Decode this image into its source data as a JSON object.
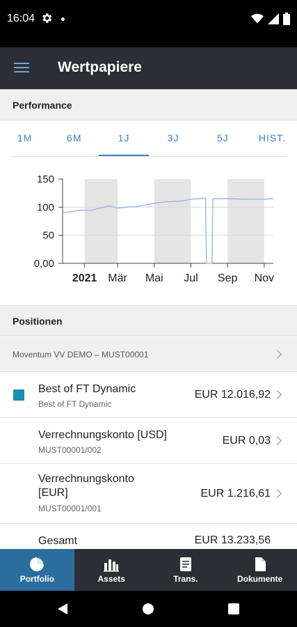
{
  "status": {
    "time": "16:04"
  },
  "appbar": {
    "title": "Wertpapiere"
  },
  "performance": {
    "header": "Performance",
    "tabs": [
      "1M",
      "6M",
      "1J",
      "3J",
      "5J",
      "HIST."
    ],
    "active_tab": "1J"
  },
  "chart_data": {
    "type": "line",
    "y_ticks": [
      "150",
      "100",
      "50",
      "0,00"
    ],
    "x_ticks": [
      "2021",
      "Mär",
      "Mai",
      "Jul",
      "Sep",
      "Nov"
    ],
    "ylim": [
      0,
      150
    ],
    "x": [
      0,
      0.5,
      1,
      1.5,
      2,
      2.5,
      3,
      3.5,
      4,
      4.5,
      5,
      5.5,
      6,
      6.5,
      7,
      7.5,
      7.8,
      7.85,
      7.9,
      8.15,
      8.2,
      8.3,
      9,
      10,
      10.5,
      11,
      11.5
    ],
    "values": [
      90,
      92,
      95,
      94,
      98,
      102,
      98,
      100,
      101,
      104,
      107,
      109,
      110,
      111,
      114,
      115,
      116,
      0,
      0,
      0,
      114,
      115,
      115,
      114,
      114,
      114,
      115
    ],
    "line_color": "#8fb6dd",
    "shade_color": "#e5e5e5"
  },
  "positions": {
    "header": "Positionen",
    "portfolio": "Moventum VV DEMO – MUST00001",
    "rows": [
      {
        "name": "Best of FT Dynamic",
        "sub": "Best of FT Dynamic",
        "amount": "EUR 12.016,92"
      },
      {
        "name": "Verrechnungskonto [USD]",
        "sub": "MUST00001/002",
        "amount": "EUR 0,03"
      },
      {
        "name_line1": "Verrechnungskonto",
        "name_line2": "[EUR]",
        "sub": "MUST00001/001",
        "amount": "EUR 1.216,61"
      },
      {
        "name": "Gesamt",
        "amount": "EUR 13.233,56"
      }
    ]
  },
  "bottomnav": {
    "items": [
      "Portfolio",
      "Assets",
      "Trans.",
      "Dokumente"
    ],
    "active": "Portfolio"
  },
  "colors": {
    "accent": "#3a82c0",
    "appbar": "#2b2f35",
    "nav_active": "#2a6d9e",
    "square": "#1a8fb4"
  }
}
